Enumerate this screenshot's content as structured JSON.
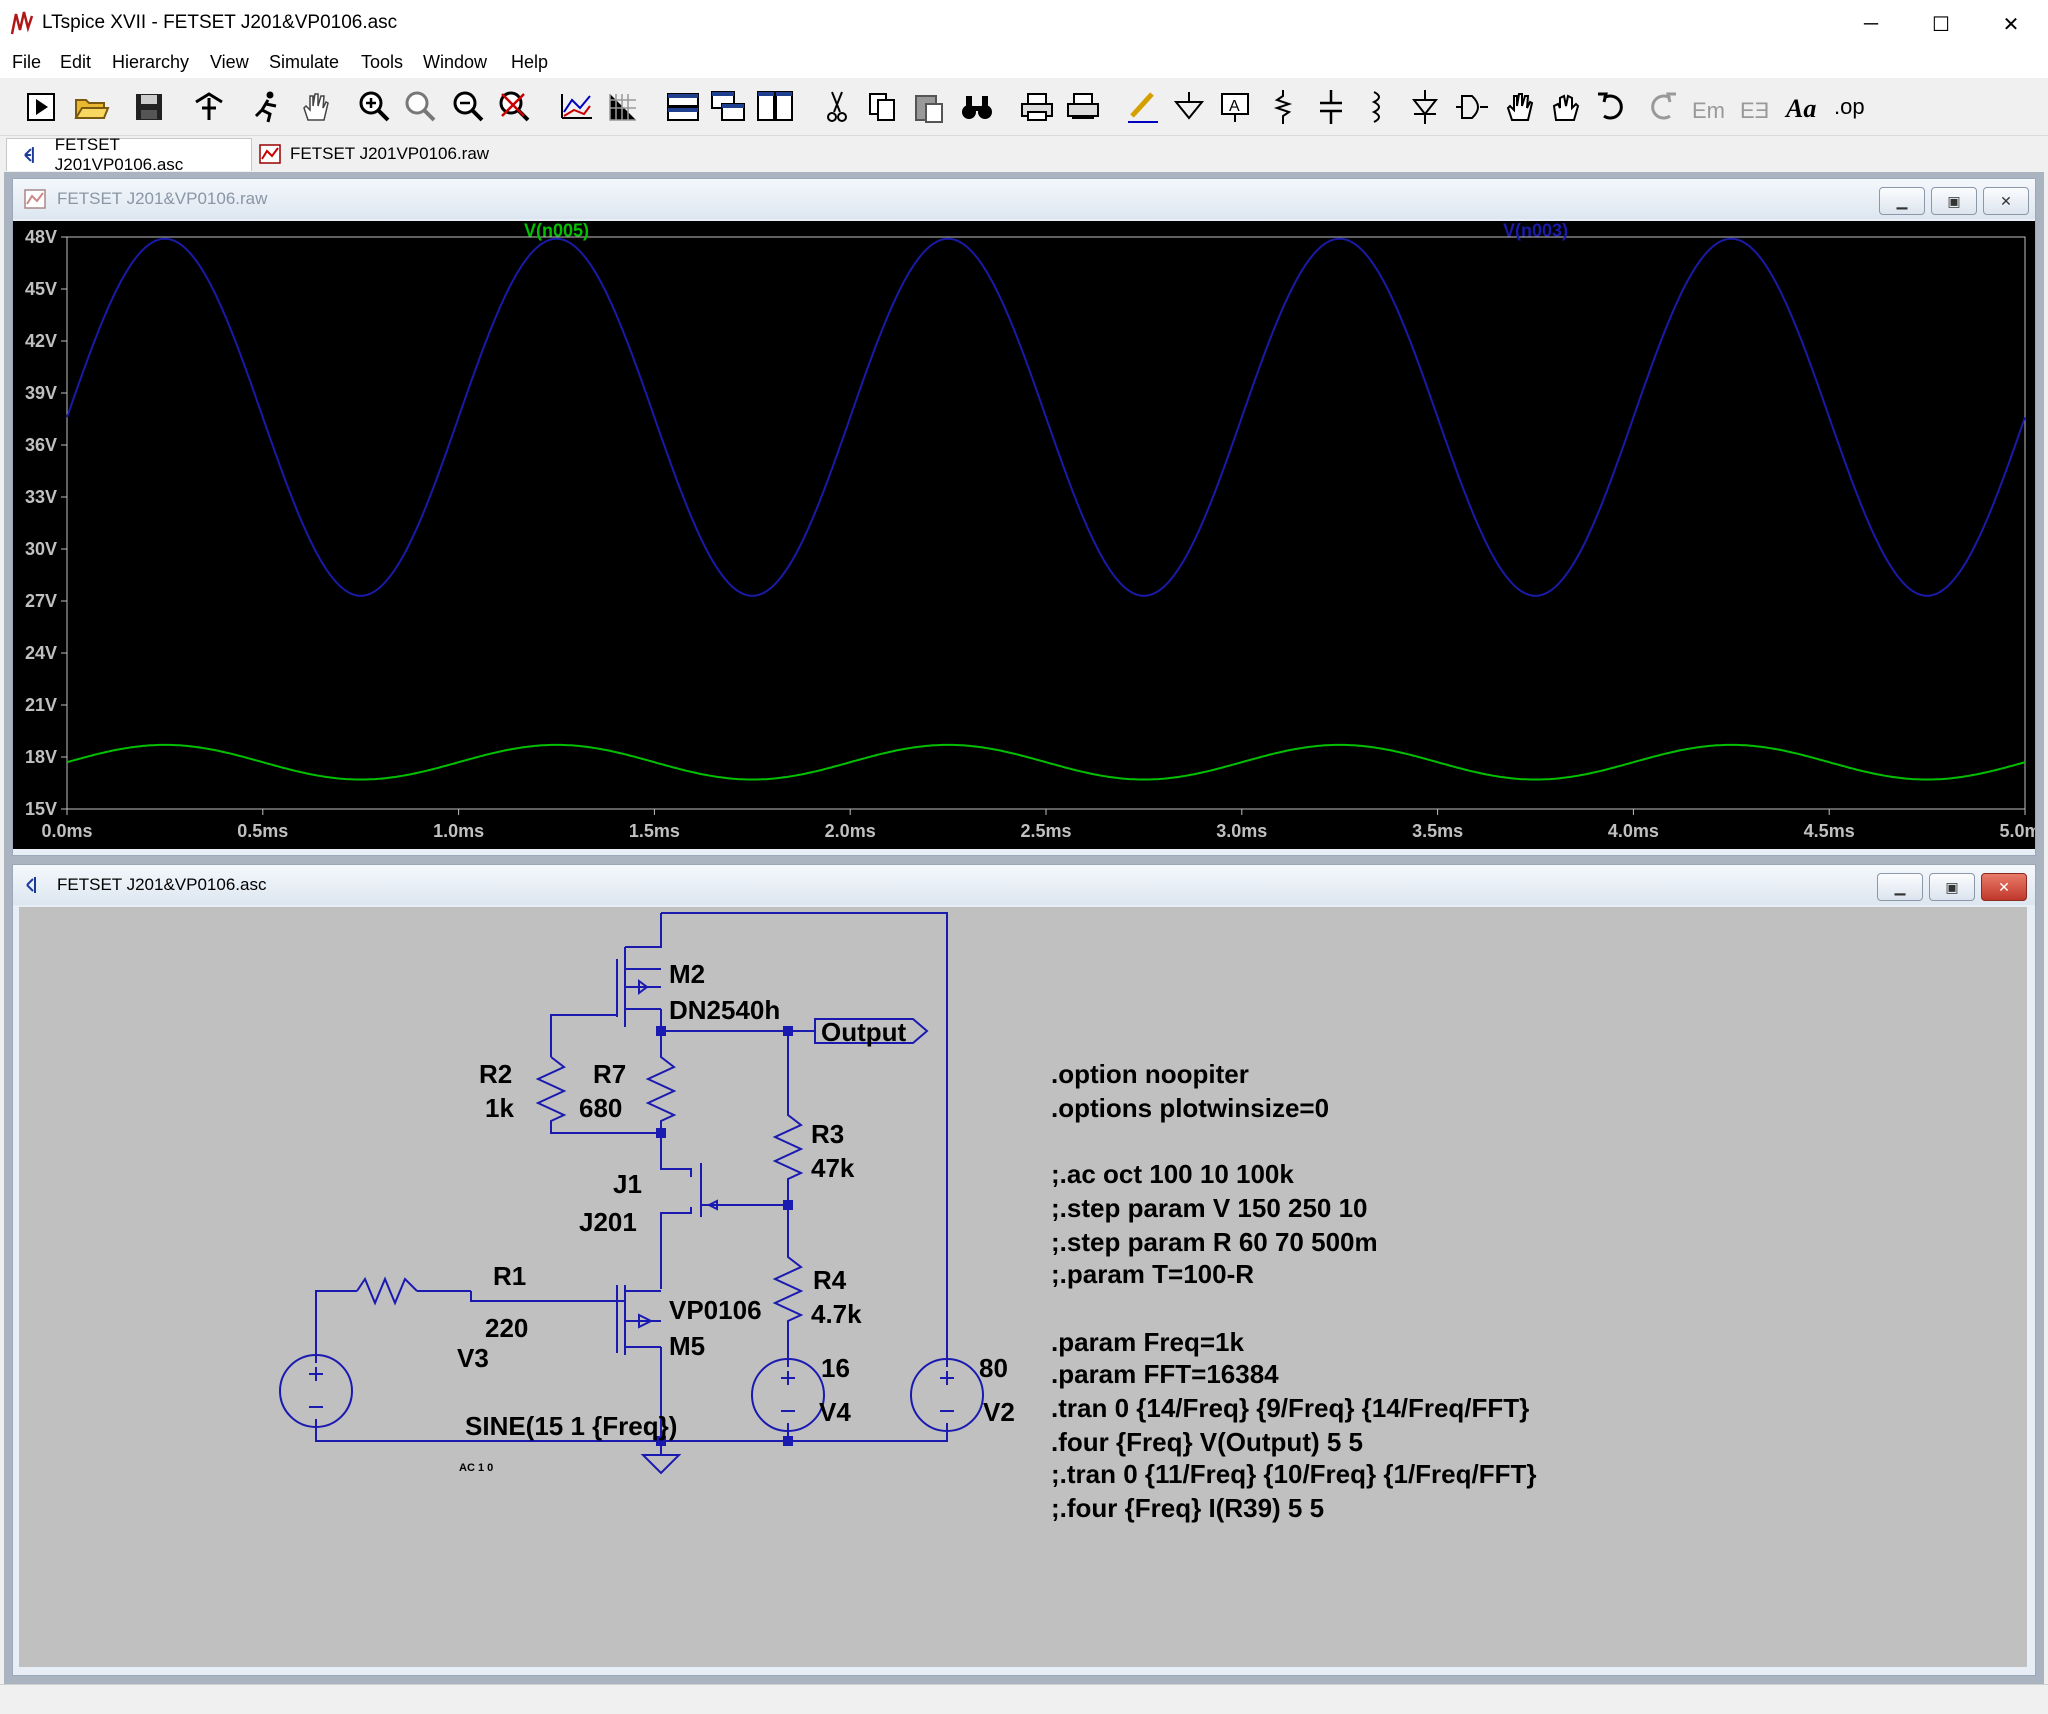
{
  "window": {
    "title": "LTspice XVII - FETSET J201&VP0106.asc",
    "minimize": "─",
    "maximize": "☐",
    "close": "✕"
  },
  "menu": [
    "File",
    "Edit",
    "Hierarchy",
    "View",
    "Simulate",
    "Tools",
    "Window",
    "Help"
  ],
  "toolbar_icons": [
    "run-icon",
    "open-icon",
    "save-icon",
    "control-panel-icon",
    "halt-icon",
    "pan-icon",
    "zoom-in-icon",
    "zoom-area-icon",
    "zoom-out-icon",
    "zoom-fit-icon",
    "autorange-icon",
    "grid-icon",
    "tile-horizontal-icon",
    "cascade-icon",
    "tile-vertical-icon",
    "cut-icon",
    "copy-icon",
    "paste-icon",
    "find-icon",
    "print-icon",
    "print-setup-icon",
    "draw-wire-icon",
    "ground-icon",
    "label-net-icon",
    "resistor-icon",
    "capacitor-icon",
    "inductor-icon",
    "diode-icon",
    "component-icon",
    "move-icon",
    "drag-icon",
    "undo-icon",
    "redo-icon",
    "rotate-icon",
    "mirror-icon",
    "text-icon",
    "spice-directive-icon"
  ],
  "tabs": [
    {
      "label": "FETSET J201VP0106.asc",
      "active": true
    },
    {
      "label": "FETSET J201VP0106.raw",
      "active": false
    }
  ],
  "waveform_window": {
    "title": "FETSET J201&VP0106.raw"
  },
  "chart_data": {
    "type": "line",
    "title": "",
    "xlabel": "",
    "ylabel": "",
    "xlim": [
      0,
      5.0
    ],
    "ylim": [
      15,
      48
    ],
    "x_ticks": [
      "0.0ms",
      "0.5ms",
      "1.0ms",
      "1.5ms",
      "2.0ms",
      "2.5ms",
      "3.0ms",
      "3.5ms",
      "4.0ms",
      "4.5ms",
      "5.0ms"
    ],
    "y_ticks": [
      "15V",
      "18V",
      "21V",
      "24V",
      "27V",
      "30V",
      "33V",
      "36V",
      "39V",
      "42V",
      "45V",
      "48V"
    ],
    "grid": false,
    "background": "#000000",
    "series": [
      {
        "name": "V(n005)",
        "color": "#00c000",
        "offset": 17.7,
        "amplitude": 1.0,
        "freq_per_ms": 1,
        "phase_deg": 0
      },
      {
        "name": "V(n003)",
        "color": "#1a1aa8",
        "offset": 37.6,
        "amplitude": 10.3,
        "freq_per_ms": 1,
        "phase_deg": 0
      }
    ]
  },
  "schematic_window": {
    "title": "FETSET J201&VP0106.asc"
  },
  "schematic": {
    "labels": {
      "m2": "M2",
      "m2_model": "DN2540h",
      "r2": "R2",
      "r2_val": "1k",
      "r7": "R7",
      "r7_val": "680",
      "r3": "R3",
      "r3_val": "47k",
      "j1": "J1",
      "j1_model": "J201",
      "r1": "R1",
      "r1_val": "220",
      "r4": "R4",
      "r4_val": "4.7k",
      "m5": "M5",
      "m5_model": "VP0106",
      "v3": "V3",
      "v3_val": "SINE(15 1 {Freq})",
      "v3_ac": "AC 1 0",
      "v4": "V4",
      "v4_val": "16",
      "v2": "V2",
      "v2_val": "80",
      "output": "Output"
    },
    "directives": [
      ".option noopiter",
      ".options plotwinsize=0",
      "",
      ";.ac oct 100 10 100k",
      ";.step param V 150 250 10",
      ";.step param R 60 70 500m",
      ";.param T=100-R",
      "",
      ".param Freq=1k",
      ".param FFT=16384",
      ".tran 0 {14/Freq} {9/Freq} {14/Freq/FFT}",
      ".four {Freq} V(Output) 5 5",
      ";.tran 0 {11/Freq} {10/Freq} {1/Freq/FFT}",
      ";.four {Freq} I(R39) 5 5"
    ]
  }
}
